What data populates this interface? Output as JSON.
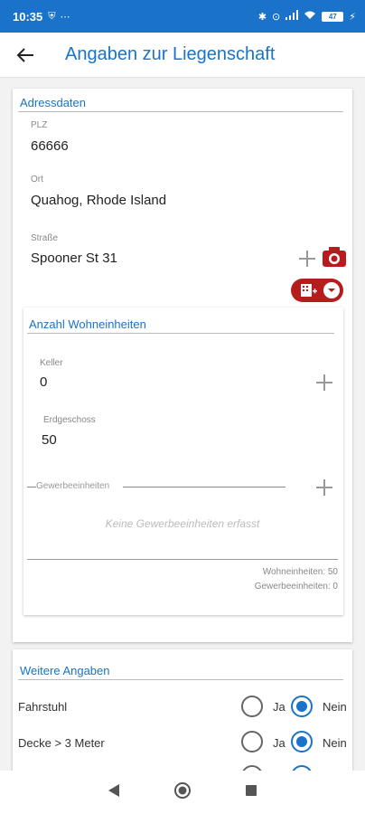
{
  "status_bar": {
    "time": "10:35",
    "battery": "47"
  },
  "app_bar": {
    "title": "Angaben zur Liegenschaft"
  },
  "address": {
    "section_title": "Adressdaten",
    "plz_label": "PLZ",
    "plz_value": "66666",
    "ort_label": "Ort",
    "ort_value": "Quahog, Rhode Island",
    "strasse_label": "Straße",
    "strasse_value": "Spooner St 31"
  },
  "units": {
    "section_title": "Anzahl Wohneinheiten",
    "keller_label": "Keller",
    "keller_value": "0",
    "erdgeschoss_label": "Erdgeschoss",
    "erdgeschoss_value": "50",
    "gewerbe_label": "Gewerbeeinheiten",
    "gewerbe_empty": "Keine Gewerbeeinheiten erfasst",
    "summary_wohn": "Wohneinheiten: 50",
    "summary_gewerbe": "Gewerbeeinheiten: 0"
  },
  "more": {
    "section_title": "Weitere Angaben",
    "rows": [
      {
        "label": "Fahrstuhl",
        "yes": "Ja",
        "no": "Nein",
        "selected": "no"
      },
      {
        "label": "Decke > 3 Meter",
        "yes": "Ja",
        "no": "Nein",
        "selected": "no"
      }
    ]
  },
  "colors": {
    "primary": "#1a73c8",
    "accent_red": "#b71c1c"
  }
}
